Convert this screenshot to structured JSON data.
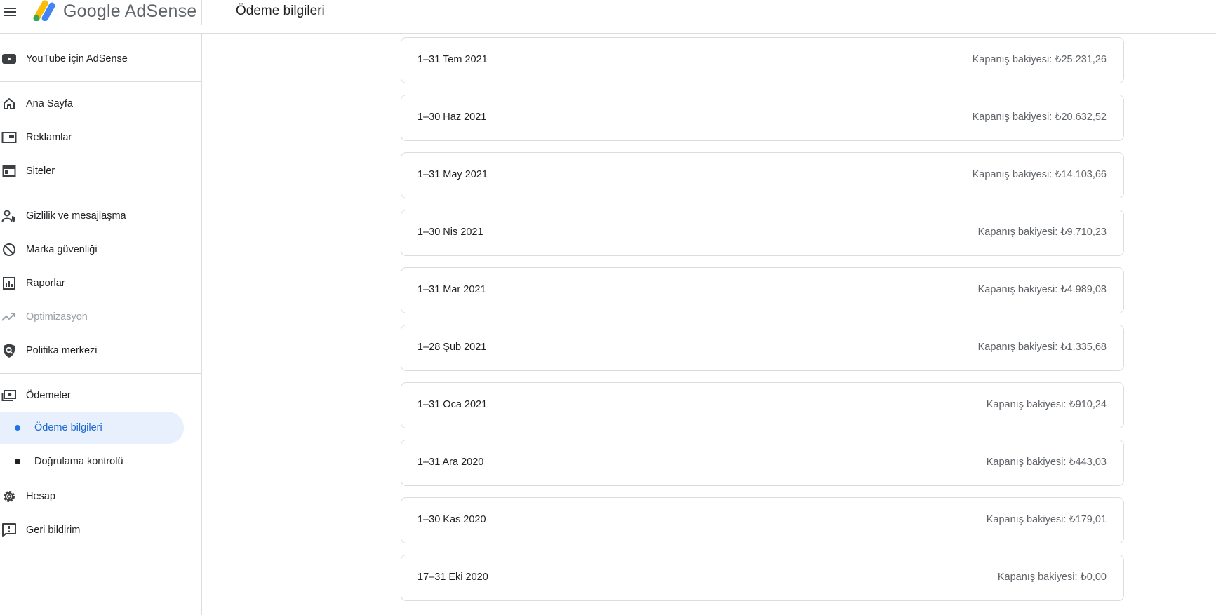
{
  "header": {
    "logo_text": "Google AdSense",
    "page_title": "Ödeme bilgileri"
  },
  "sidebar": {
    "items": [
      {
        "label": "YouTube için AdSense",
        "icon": "youtube-icon"
      },
      {
        "label": "Ana Sayfa",
        "icon": "home-icon"
      },
      {
        "label": "Reklamlar",
        "icon": "ads-icon"
      },
      {
        "label": "Siteler",
        "icon": "sites-icon"
      },
      {
        "label": "Gizlilik ve mesajlaşma",
        "icon": "privacy-icon"
      },
      {
        "label": "Marka güvenliği",
        "icon": "block-icon"
      },
      {
        "label": "Raporlar",
        "icon": "reports-icon"
      },
      {
        "label": "Optimizasyon",
        "icon": "trending-up-icon",
        "disabled": true
      },
      {
        "label": "Politika merkezi",
        "icon": "policy-shield-icon"
      },
      {
        "label": "Ödemeler",
        "icon": "payments-icon"
      },
      {
        "label": "Hesap",
        "icon": "gear-icon"
      },
      {
        "label": "Geri bildirim",
        "icon": "feedback-icon"
      }
    ],
    "sub_items": [
      {
        "label": "Ödeme bilgileri",
        "active": true
      },
      {
        "label": "Doğrulama kontrolü",
        "active": false
      }
    ]
  },
  "statements": [
    {
      "period": "1–31 Tem 2021",
      "balance": "Kapanış bakiyesi: ₺25.231,26"
    },
    {
      "period": "1–30 Haz 2021",
      "balance": "Kapanış bakiyesi: ₺20.632,52"
    },
    {
      "period": "1–31 May 2021",
      "balance": "Kapanış bakiyesi: ₺14.103,66"
    },
    {
      "period": "1–30 Nis 2021",
      "balance": "Kapanış bakiyesi: ₺9.710,23"
    },
    {
      "period": "1–31 Mar 2021",
      "balance": "Kapanış bakiyesi: ₺4.989,08"
    },
    {
      "period": "1–28 Şub 2021",
      "balance": "Kapanış bakiyesi: ₺1.335,68"
    },
    {
      "period": "1–31 Oca 2021",
      "balance": "Kapanış bakiyesi: ₺910,24"
    },
    {
      "period": "1–31 Ara 2020",
      "balance": "Kapanış bakiyesi: ₺443,03"
    },
    {
      "period": "1–30 Kas 2020",
      "balance": "Kapanış bakiyesi: ₺179,01"
    },
    {
      "period": "17–31 Eki 2020",
      "balance": "Kapanış bakiyesi: ₺0,00"
    }
  ],
  "colors": {
    "accent": "#1a73e8",
    "active_bg": "#e8f0fe",
    "border": "#dadce0",
    "logo_yellow": "#fbbc04",
    "logo_blue": "#4285f4",
    "logo_green": "#34a853"
  }
}
